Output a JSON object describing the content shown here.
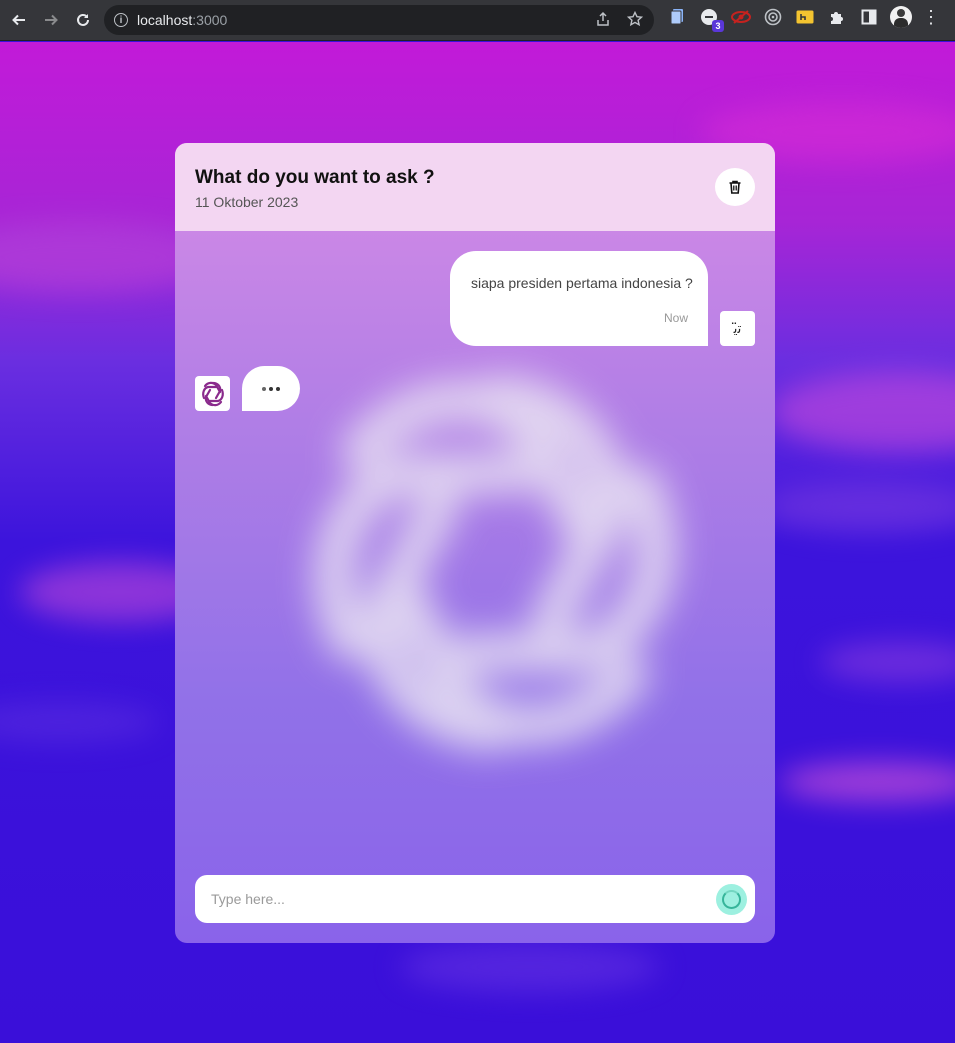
{
  "browser": {
    "url_host": "localhost",
    "url_port": ":3000",
    "extension_badge": "3"
  },
  "chat": {
    "title": "What do you want to ask ?",
    "date": "11 Oktober 2023",
    "messages": [
      {
        "role": "user",
        "text": "siapa presiden pertama indonesia ?",
        "time": "Now",
        "avatar_text": "ﺗ̈ﯾ"
      }
    ],
    "input": {
      "placeholder": "Type here...",
      "value": ""
    }
  },
  "colors": {
    "header_bg": "#f3d6f2",
    "send_button": "#9df0e0",
    "bot_logo": "#8a2a8c"
  },
  "icons": {
    "delete": "trash-icon",
    "bot": "openai-logo-icon",
    "send": "loading-spinner-icon"
  }
}
